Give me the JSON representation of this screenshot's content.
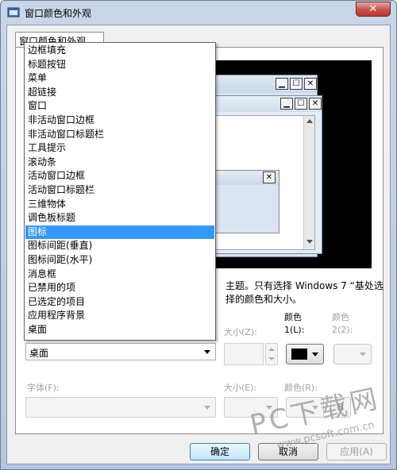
{
  "window": {
    "title": "窗口颜色和外观",
    "close_label": "✕"
  },
  "tab": {
    "label": "窗口颜色和外观"
  },
  "preview": {
    "minimize": "▁",
    "maximize": "☐",
    "close": "✕"
  },
  "description": "主题。只有选择 Windows 7 “基处选择的颜色和大小。",
  "item_section": {
    "size_label": "大小(Z):",
    "color1_label": "颜色 1(L):",
    "color2_label": "颜色 2(2):",
    "selected_value": "桌面"
  },
  "font_section": {
    "font_label": "字体(F):",
    "size_label": "大小(E):",
    "color_label": "颜色(R):",
    "bold_label": "B"
  },
  "dropdown": {
    "items": [
      "边框填充",
      "标题按钮",
      "菜单",
      "超链接",
      "窗口",
      "非活动窗口边框",
      "非活动窗口标题栏",
      "工具提示",
      "滚动条",
      "活动窗口边框",
      "活动窗口标题栏",
      "三维物体",
      "调色板标题",
      "图标",
      "图标间距(垂直)",
      "图标间距(水平)",
      "消息框",
      "已禁用的项",
      "已选定的项目",
      "应用程序背景",
      "桌面"
    ],
    "selected_index": 13
  },
  "buttons": {
    "ok": "确定",
    "cancel": "取消",
    "apply": "应用(A)"
  },
  "watermark": {
    "brand": "PC下载网",
    "url": "www.pcsoft.com.cn"
  },
  "colors": {
    "selection": "#3399ff",
    "color1": "#000000"
  }
}
